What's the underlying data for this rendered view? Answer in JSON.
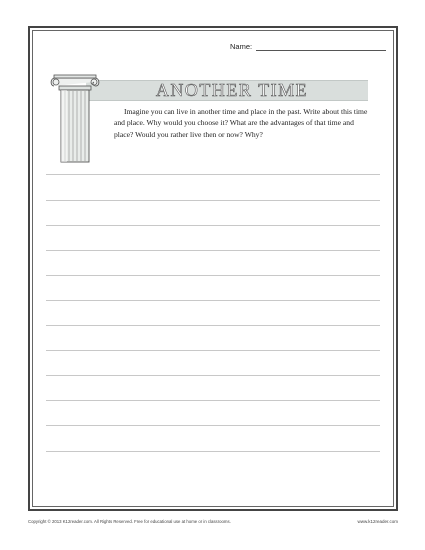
{
  "header": {
    "name_label": "Name:"
  },
  "title": "ANOTHER TIME",
  "icon": "ionic-column-icon",
  "prompt": "Imagine you can live in another time and place in the past. Write about this time and place. Why would you choose it? What are the advantages of that time and place? Would you rather live then or now? Why?",
  "writing_lines_count": 12,
  "footer": {
    "copyright": "Copyright © 2013 K12reader.com. All Rights Reserved. Free for educational use at home or in classrooms.",
    "website": "www.k12reader.com"
  }
}
